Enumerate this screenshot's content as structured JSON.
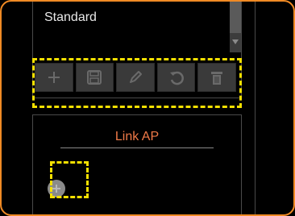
{
  "profiles": {
    "items": [
      "Standard"
    ]
  },
  "toolbar": {
    "buttons": [
      {
        "name": "add-profile-button",
        "icon": "plus-icon"
      },
      {
        "name": "save-profile-button",
        "icon": "save-icon"
      },
      {
        "name": "edit-profile-button",
        "icon": "pencil-icon"
      },
      {
        "name": "reset-profile-button",
        "icon": "undo-icon"
      },
      {
        "name": "delete-profile-button",
        "icon": "trash-icon"
      }
    ]
  },
  "link_ap": {
    "title": "Link AP"
  },
  "colors": {
    "frame_border": "#f08a24",
    "highlight": "#f5e000",
    "link_title": "#f07a48"
  }
}
